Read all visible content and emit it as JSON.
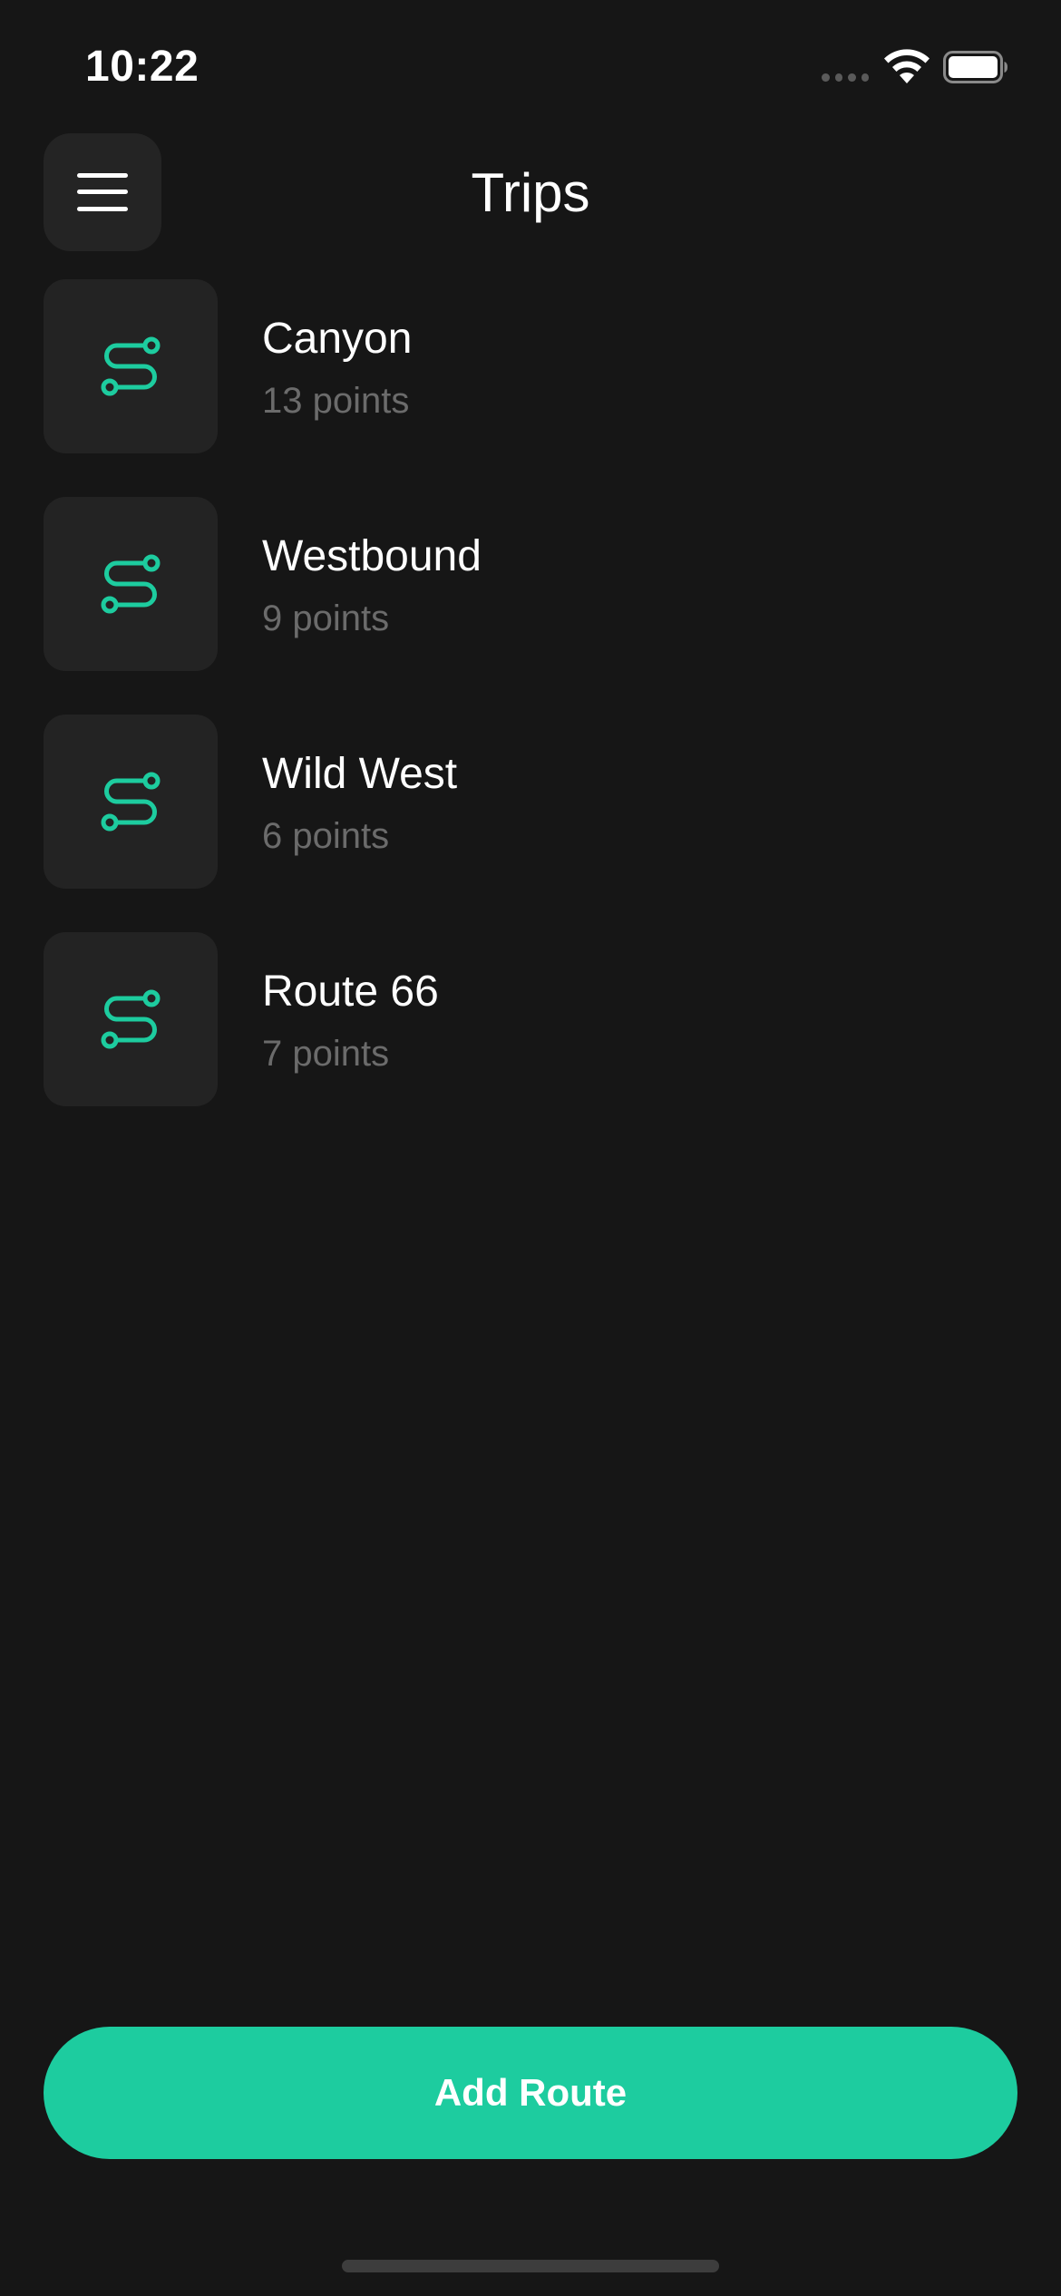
{
  "status_bar": {
    "time": "10:22",
    "icons": [
      "cellular-signal-icon",
      "wifi-icon",
      "battery-icon"
    ]
  },
  "header": {
    "title": "Trips",
    "menu_icon": "hamburger-menu-icon"
  },
  "routes": [
    {
      "name": "Canyon",
      "points": "13 points",
      "icon": "route-icon"
    },
    {
      "name": "Westbound",
      "points": "9 points",
      "icon": "route-icon"
    },
    {
      "name": "Wild West",
      "points": "6 points",
      "icon": "route-icon"
    },
    {
      "name": "Route 66",
      "points": "7 points",
      "icon": "route-icon"
    }
  ],
  "actions": {
    "add_route_label": "Add Route"
  },
  "colors": {
    "background": "#161616",
    "card": "#232323",
    "accent": "#1dcc9f",
    "secondary_text": "#6b6b6b"
  }
}
